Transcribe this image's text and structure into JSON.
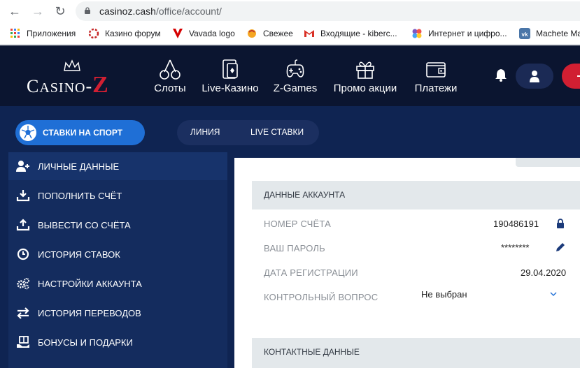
{
  "browser": {
    "url_host": "casinoz.cash",
    "url_path": "/office/account/",
    "bookmarks": [
      {
        "label": "Приложения",
        "icon": "apps-grid-icon"
      },
      {
        "label": "Казино форум",
        "icon": "forum-icon"
      },
      {
        "label": "Vavada logo",
        "icon": "vavada-icon"
      },
      {
        "label": "Свежее",
        "icon": "fresh-icon"
      },
      {
        "label": "Входящие - kiberc...",
        "icon": "gmail-icon"
      },
      {
        "label": "Интернет и цифро...",
        "icon": "puzzle-icon"
      },
      {
        "label": "Machete Ma",
        "icon": "vk-icon"
      }
    ]
  },
  "header": {
    "logo": "Casino-Z",
    "nav": [
      {
        "label": "Слоты",
        "icon": "cherries-icon"
      },
      {
        "label": "Live-Казино",
        "icon": "live-cards-icon"
      },
      {
        "label": "Z-Games",
        "icon": "gamepad-icon"
      },
      {
        "label": "Промо акции",
        "icon": "gift-icon"
      },
      {
        "label": "Платежи",
        "icon": "wallet-icon"
      }
    ]
  },
  "sport": {
    "button_label": "СТАВКИ НА СПОРТ",
    "tabs": [
      "ЛИНИЯ",
      "LIVE СТАВКИ"
    ]
  },
  "sidebar": {
    "items": [
      {
        "label": "ЛИЧНЫЕ ДАННЫЕ",
        "icon": "user-plus-icon"
      },
      {
        "label": "ПОПОЛНИТЬ СЧЁТ",
        "icon": "download-icon"
      },
      {
        "label": "ВЫВЕСТИ СО СЧЁТА",
        "icon": "upload-icon"
      },
      {
        "label": "ИСТОРИЯ СТАВОК",
        "icon": "clock-icon"
      },
      {
        "label": "НАСТРОЙКИ АККАУНТА",
        "icon": "gears-icon"
      },
      {
        "label": "ИСТОРИЯ ПЕРЕВОДОВ",
        "icon": "transfer-arrows-icon"
      },
      {
        "label": "БОНУСЫ И ПОДАРКИ",
        "icon": "gift-hand-icon"
      }
    ]
  },
  "account": {
    "section_title": "ДАННЫЕ АККАУНТА",
    "rows": [
      {
        "label": "НОМЕР СЧЁТА",
        "value": "190486191",
        "icon": "lock-icon"
      },
      {
        "label": "ВАШ ПАРОЛЬ",
        "value": "********",
        "icon": "pencil-icon"
      },
      {
        "label": "ДАТА РЕГИСТРАЦИИ",
        "value": "29.04.2020"
      },
      {
        "label": "КОНТРОЛЬНЫЙ ВОПРОС",
        "value": "Не выбран",
        "icon": "chevron-down-icon"
      }
    ]
  },
  "contacts": {
    "section_title": "КОНТАКТНЫЕ ДАННЫЕ"
  },
  "colors": {
    "header_bg": "#0b1530",
    "sport_bar_bg": "#0f2452",
    "accent_red": "#d11f32",
    "accent_blue": "#1f6fd6",
    "icon_navy": "#1b3a7a"
  }
}
